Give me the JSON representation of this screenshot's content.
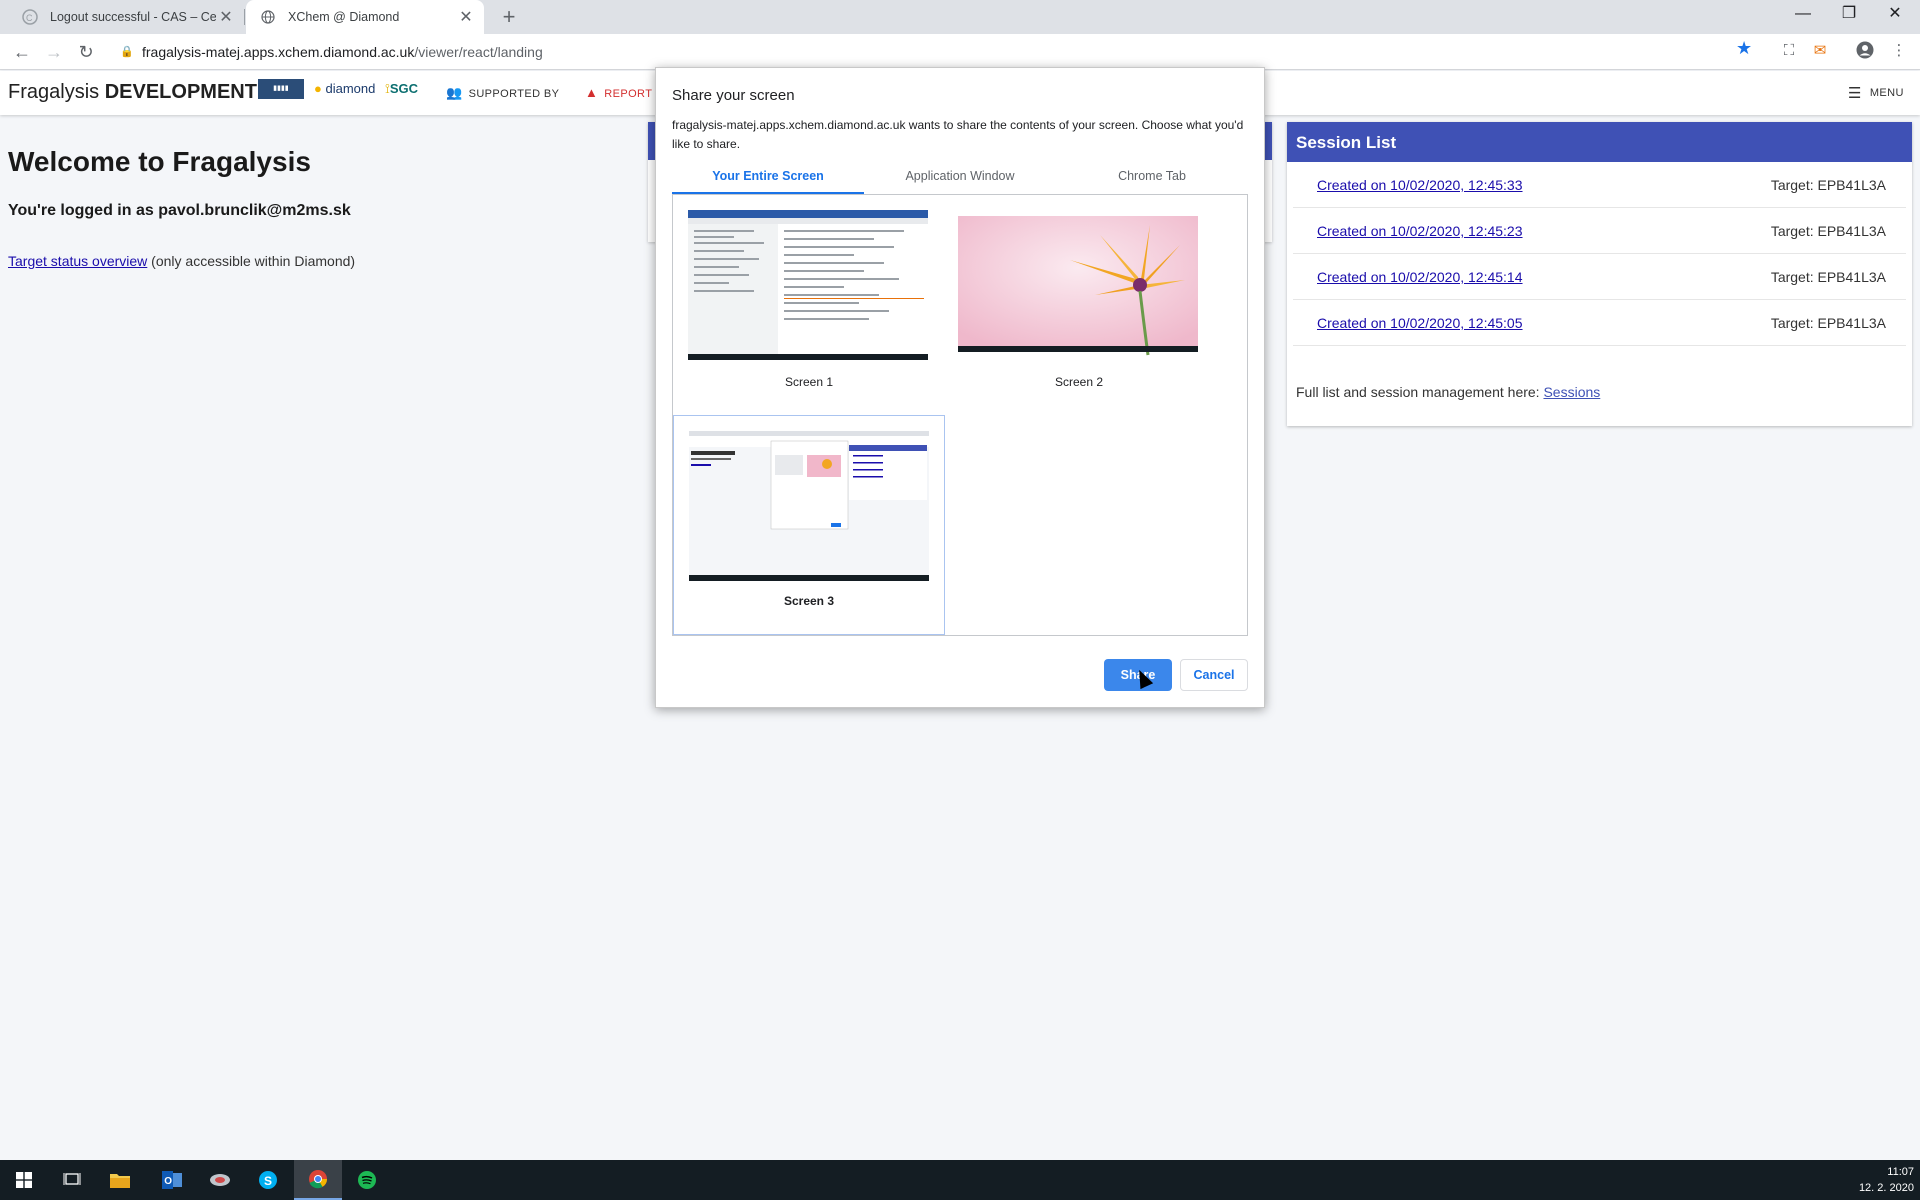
{
  "browser": {
    "tabs": [
      {
        "title": "Logout successful - CAS – Centra",
        "favicon": "cas-favicon",
        "active": false
      },
      {
        "title": "XChem @ Diamond",
        "favicon": "globe-icon",
        "active": true
      }
    ],
    "url_host": "fragalysis-matej.apps.xchem.diamond.ac.uk",
    "url_path": "/viewer/react/landing"
  },
  "app": {
    "brand_prefix": "Fragalysis",
    "brand_suffix": "DEVELOPMENT",
    "logo_diamond": "diamond",
    "logo_sgc": "SGC",
    "supported_by": "SUPPORTED BY",
    "report": "REPORT",
    "menu": "MENU"
  },
  "landing": {
    "welcome": "Welcome to Fragalysis",
    "logged_in": "You're logged in as pavol.brunclik@m2ms.sk",
    "target_link": "Target status overview",
    "target_note": " (only accessible within Diamond)"
  },
  "sessions": {
    "title": "Session List",
    "items": [
      {
        "created": "Created on 10/02/2020, 12:45:33",
        "target": "Target: EPB41L3A"
      },
      {
        "created": "Created on 10/02/2020, 12:45:23",
        "target": "Target: EPB41L3A"
      },
      {
        "created": "Created on 10/02/2020, 12:45:14",
        "target": "Target: EPB41L3A"
      },
      {
        "created": "Created on 10/02/2020, 12:45:05",
        "target": "Target: EPB41L3A"
      }
    ],
    "footer_text": "Full list and session management here: ",
    "footer_link": "Sessions"
  },
  "share_dialog": {
    "title": "Share your screen",
    "description": "fragalysis-matej.apps.xchem.diamond.ac.uk wants to share the contents of your screen. Choose what you'd like to share.",
    "tabs": [
      "Your Entire Screen",
      "Application Window",
      "Chrome Tab"
    ],
    "selected_tab": "Your Entire Screen",
    "screens": [
      {
        "label": "Screen 1",
        "selected": false
      },
      {
        "label": "Screen 2",
        "selected": false
      },
      {
        "label": "Screen 3",
        "selected": true
      }
    ],
    "share_label": "Share",
    "cancel_label": "Cancel"
  },
  "taskbar": {
    "apps": [
      "windows-start-icon",
      "task-view-icon",
      "file-explorer-icon",
      "outlook-icon",
      "app-icon",
      "skype-icon",
      "chrome-icon",
      "spotify-icon"
    ],
    "active_app": "chrome-icon",
    "time": "11:07",
    "date": "12. 2. 2020"
  },
  "colors": {
    "primary": "#3f51b5",
    "chrome_blue": "#1a73e8",
    "report_red": "#d32f2f",
    "page_bg": "#f4f6f9"
  }
}
